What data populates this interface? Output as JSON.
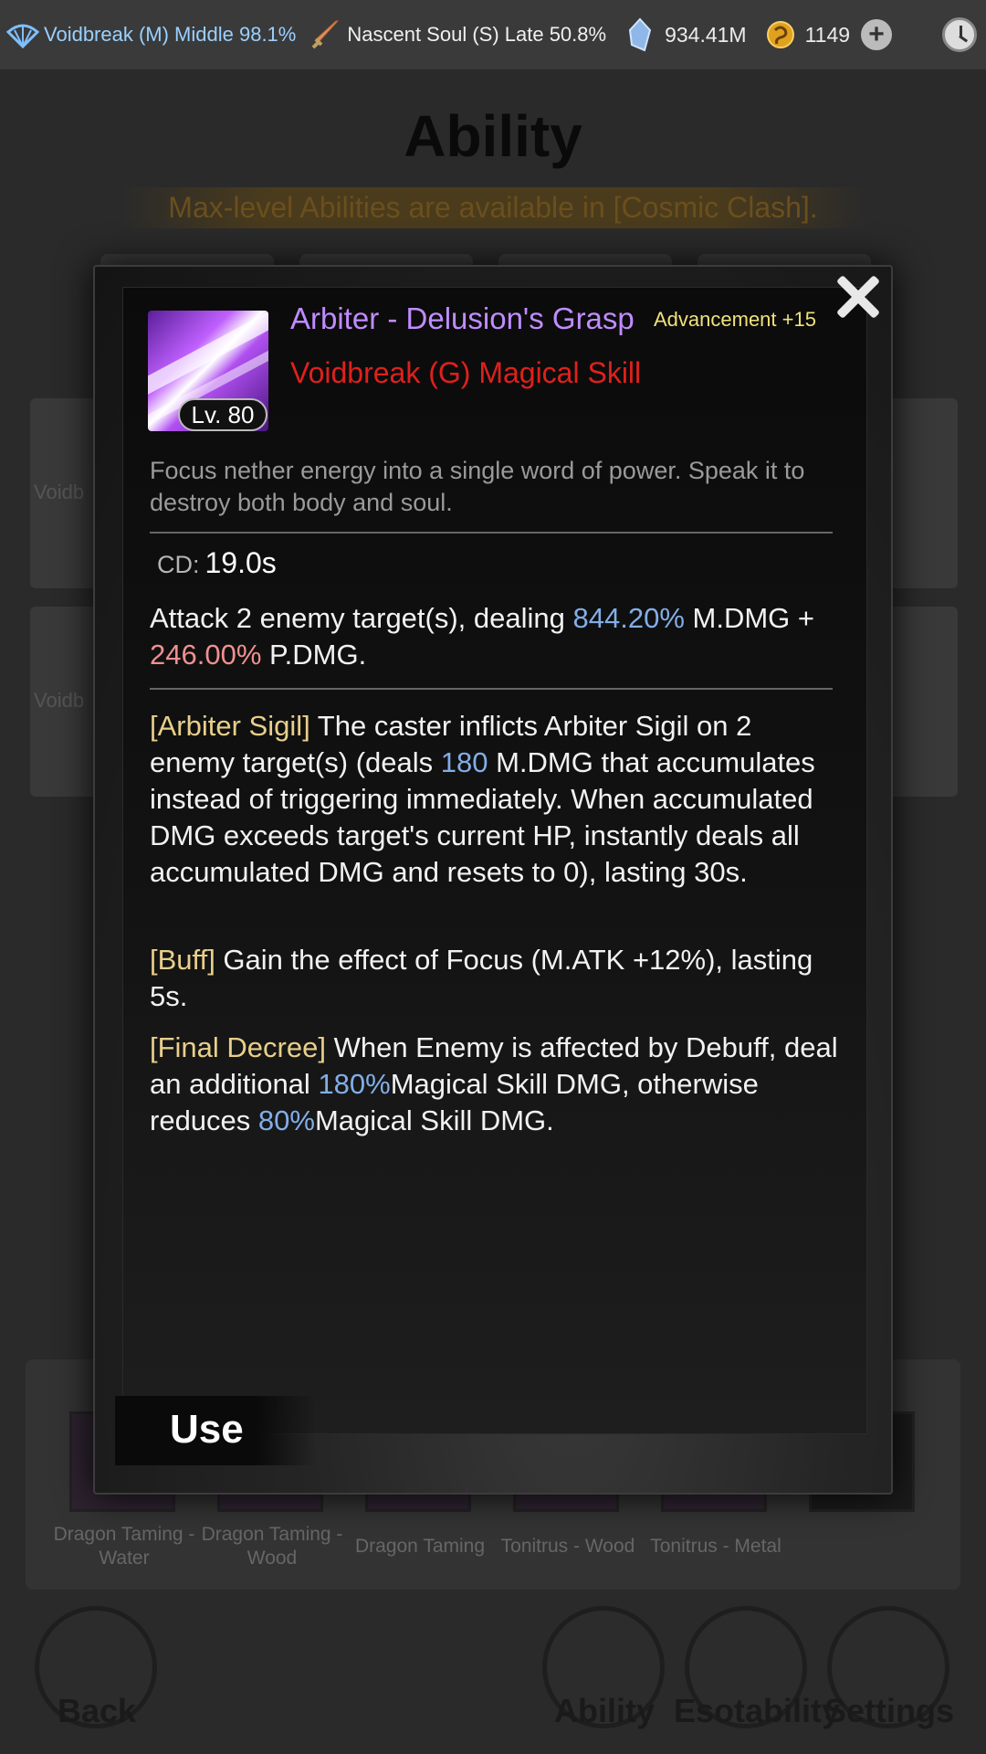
{
  "topbar": {
    "cultivation_main": "Voidbreak (M) Middle 98.1%",
    "cultivation_secondary": "Nascent Soul (S) Late 50.8%",
    "spirit_stones": "934.41M",
    "currency_two": "1149"
  },
  "page": {
    "title": "Ability",
    "notice": "Max-level Abilities are available in [Cosmic Clash].",
    "card_text": "Voidb",
    "skill_labels": [
      "Dragon Taming - Water",
      "Dragon Taming - Wood",
      "Dragon Taming",
      "Tonitrus - Wood",
      "Tonitrus - Metal"
    ],
    "nav": {
      "back": "Back",
      "ability": "Ability",
      "esotability": "Esotability",
      "settings": "Settings"
    }
  },
  "skill": {
    "name": "Arbiter - Delusion's Grasp",
    "advancement": "Advancement +15",
    "type": "Voidbreak (G) Magical Skill",
    "level": "Lv. 80",
    "description": "Focus nether energy into a single word of power. Speak it to destroy both body and soul.",
    "cd_label": "CD:",
    "cd_value": "19.0s",
    "attack": {
      "part1": "Attack 2 enemy target(s), dealing ",
      "mdmg_pct": "844.20%",
      "part2": " M.DMG + ",
      "pdmg_pct": "246.00%",
      "part3": " P.DMG."
    },
    "sigil": {
      "tag": "[Arbiter Sigil]",
      "part1": " The caster inflicts Arbiter Sigil on 2 enemy target(s) (deals ",
      "value": "180",
      "part2": " M.DMG that accumulates instead of triggering immediately. When accumulated DMG exceeds target's current HP, instantly deals all accumulated DMG and resets to 0), lasting 30s."
    },
    "buff": {
      "tag": "[Buff]",
      "text": " Gain the effect of Focus (M.ATK +12%), lasting 5s."
    },
    "decree": {
      "tag": "[Final Decree]",
      "part1": " When Enemy is affected by Debuff, deal an additional ",
      "bonus": "180%",
      "part2": "Magical Skill DMG, otherwise reduces ",
      "penalty": "80%",
      "part3": "Magical Skill DMG."
    },
    "use_label": "Use"
  },
  "colors": {
    "skill_name": "#c08cff",
    "skill_type": "#e0201c",
    "advancement": "#f0e27a",
    "value_blue": "#82aee8",
    "value_pink": "#f09090",
    "tag_gold": "#e8cf8a"
  },
  "icons": [
    "fan-icon",
    "sword-icon",
    "crystal-icon",
    "coin-icon",
    "plus-icon",
    "clock-icon",
    "close-icon",
    "skill-icon"
  ]
}
